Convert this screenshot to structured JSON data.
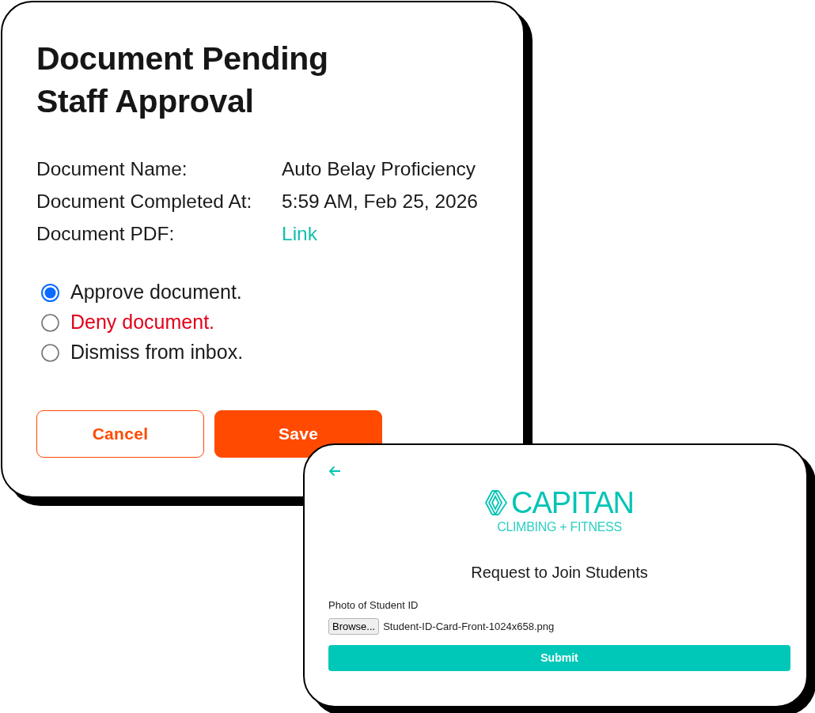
{
  "approval_card": {
    "title": "Document Pending Staff Approval",
    "fields": [
      {
        "label": "Document Name:",
        "value": "Auto Belay Proficiency",
        "kind": "text"
      },
      {
        "label": "Document Completed At:",
        "value": "5:59 AM, Feb 25, 2026",
        "kind": "text"
      },
      {
        "label": "Document PDF:",
        "value": "Link",
        "kind": "link"
      }
    ],
    "options": [
      {
        "label": "Approve document.",
        "selected": true,
        "kind": "normal"
      },
      {
        "label": "Deny document.",
        "selected": false,
        "kind": "danger"
      },
      {
        "label": "Dismiss from inbox.",
        "selected": false,
        "kind": "normal"
      }
    ],
    "buttons": [
      {
        "label": "Cancel",
        "kind": "secondary"
      },
      {
        "label": "Save",
        "kind": "primary"
      }
    ]
  },
  "join_card": {
    "logo": {
      "name": "CAPITAN",
      "tagline": "CLIMBING + FITNESS"
    },
    "title": "Request to Join Students",
    "file_field": {
      "label": "Photo of Student ID",
      "button": "Browse...",
      "value": "Student-ID-Card-Front-1024x658.png"
    },
    "submit": "Submit"
  }
}
